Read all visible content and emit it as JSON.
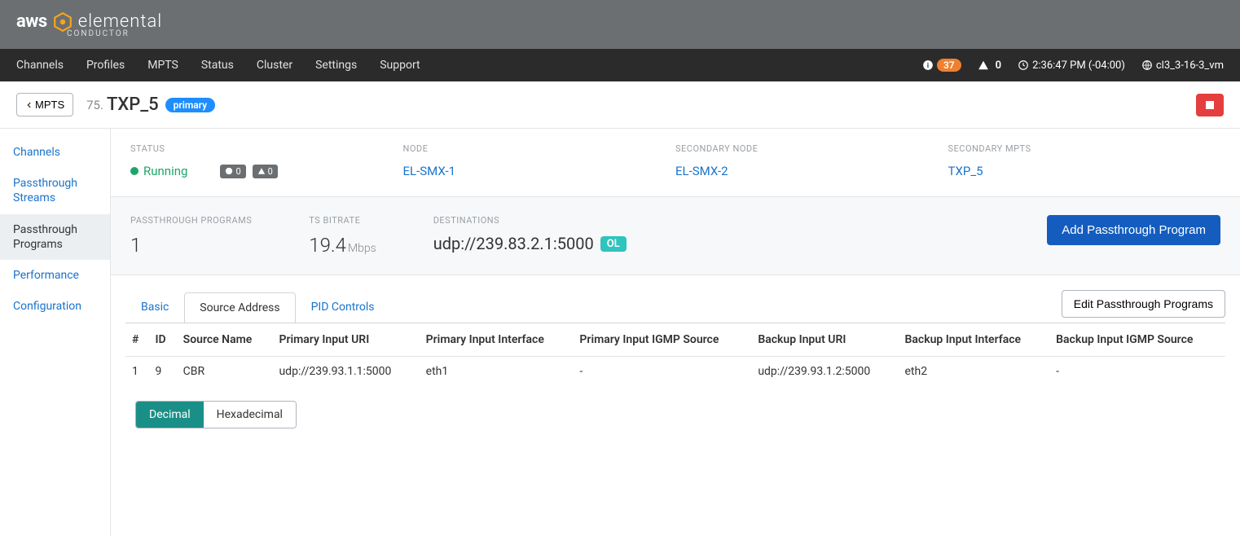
{
  "brand": {
    "aws": "aws",
    "elemental": "elemental",
    "sub": "CONDUCTOR"
  },
  "nav": {
    "items": [
      "Channels",
      "Profiles",
      "MPTS",
      "Status",
      "Cluster",
      "Settings",
      "Support"
    ],
    "info_count": "37",
    "warn_count": "0",
    "time": "2:36:47 PM (-04:00)",
    "host": "cl3_3-16-3_vm"
  },
  "title": {
    "back": "MPTS",
    "index": "75.",
    "name": "TXP_5",
    "tag": "primary"
  },
  "sidebar": {
    "items": [
      "Channels",
      "Passthrough Streams",
      "Passthrough Programs",
      "Performance",
      "Configuration"
    ],
    "active": 2
  },
  "status": {
    "status_label": "STATUS",
    "running": "Running",
    "info_badge": "0",
    "warn_badge": "0",
    "node_label": "NODE",
    "node": "EL-SMX-1",
    "secondary_node_label": "SECONDARY NODE",
    "secondary_node": "EL-SMX-2",
    "secondary_mpts_label": "SECONDARY MPTS",
    "secondary_mpts": "TXP_5"
  },
  "summary": {
    "programs_label": "PASSTHROUGH PROGRAMS",
    "programs": "1",
    "bitrate_label": "TS BITRATE",
    "bitrate": "19.4",
    "bitrate_unit": "Mbps",
    "dest_label": "DESTINATIONS",
    "dest": "udp://239.83.2.1:5000",
    "dest_tag": "OL",
    "add_btn": "Add Passthrough Program"
  },
  "tabs": {
    "items": [
      "Basic",
      "Source Address",
      "PID Controls"
    ],
    "active": 1,
    "edit_btn": "Edit Passthrough Programs"
  },
  "table": {
    "headers": [
      "#",
      "ID",
      "Source Name",
      "Primary Input URI",
      "Primary Input Interface",
      "Primary Input IGMP Source",
      "Backup Input URI",
      "Backup Input Interface",
      "Backup Input IGMP Source"
    ],
    "rows": [
      {
        "num": "1",
        "id": "9",
        "name": "CBR",
        "p_uri": "udp://239.93.1.1:5000",
        "p_if": "eth1",
        "p_igmp": "-",
        "b_uri": "udp://239.93.1.2:5000",
        "b_if": "eth2",
        "b_igmp": "-"
      }
    ]
  },
  "toggle": {
    "decimal": "Decimal",
    "hex": "Hexadecimal"
  }
}
